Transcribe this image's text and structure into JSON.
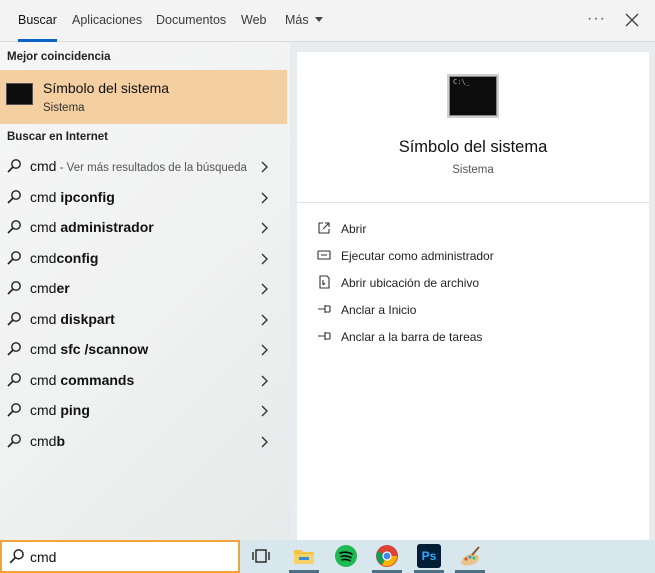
{
  "tabs": [
    {
      "label": "Buscar",
      "active": true
    },
    {
      "label": "Aplicaciones"
    },
    {
      "label": "Documentos"
    },
    {
      "label": "Web"
    },
    {
      "label": "Más"
    }
  ],
  "left": {
    "best_match_header": "Mejor coincidencia",
    "best_match": {
      "title": "Símbolo del sistema",
      "subtitle": "Sistema",
      "icon": "terminal-icon"
    },
    "web_header": "Buscar en Internet",
    "results": [
      {
        "prefix": "cmd",
        "bold": "",
        "hint": " - Ver más resultados de la búsqueda"
      },
      {
        "prefix": "cmd ",
        "bold": "ipconfig",
        "hint": ""
      },
      {
        "prefix": "cmd ",
        "bold": "administrador",
        "hint": ""
      },
      {
        "prefix": "cmd",
        "bold": "config",
        "hint": ""
      },
      {
        "prefix": "cmd",
        "bold": "er",
        "hint": ""
      },
      {
        "prefix": "cmd ",
        "bold": "diskpart",
        "hint": ""
      },
      {
        "prefix": "cmd ",
        "bold": "sfc /scannow",
        "hint": ""
      },
      {
        "prefix": "cmd ",
        "bold": "commands",
        "hint": ""
      },
      {
        "prefix": "cmd ",
        "bold": "ping",
        "hint": ""
      },
      {
        "prefix": "cmd",
        "bold": "b",
        "hint": ""
      }
    ]
  },
  "right": {
    "title": "Símbolo del sistema",
    "subtitle": "Sistema",
    "actions": [
      {
        "label": "Abrir",
        "icon": "open-icon"
      },
      {
        "label": "Ejecutar como administrador",
        "icon": "admin-shield-icon"
      },
      {
        "label": "Abrir ubicación de archivo",
        "icon": "file-location-icon"
      },
      {
        "label": "Anclar a Inicio",
        "icon": "pin-icon"
      },
      {
        "label": "Anclar a la barra de tareas",
        "icon": "pin-icon"
      }
    ]
  },
  "search": {
    "value": "cmd"
  },
  "taskbar": {
    "apps": [
      "task-view-icon",
      "file-explorer-icon",
      "spotify-icon",
      "chrome-icon",
      "photoshop-icon",
      "paint-icon"
    ],
    "photoshop_label": "Ps"
  },
  "colors": {
    "accent": "#0a63c5",
    "best_match_bg": "#f3cfa1",
    "search_border": "#f2a33a"
  }
}
